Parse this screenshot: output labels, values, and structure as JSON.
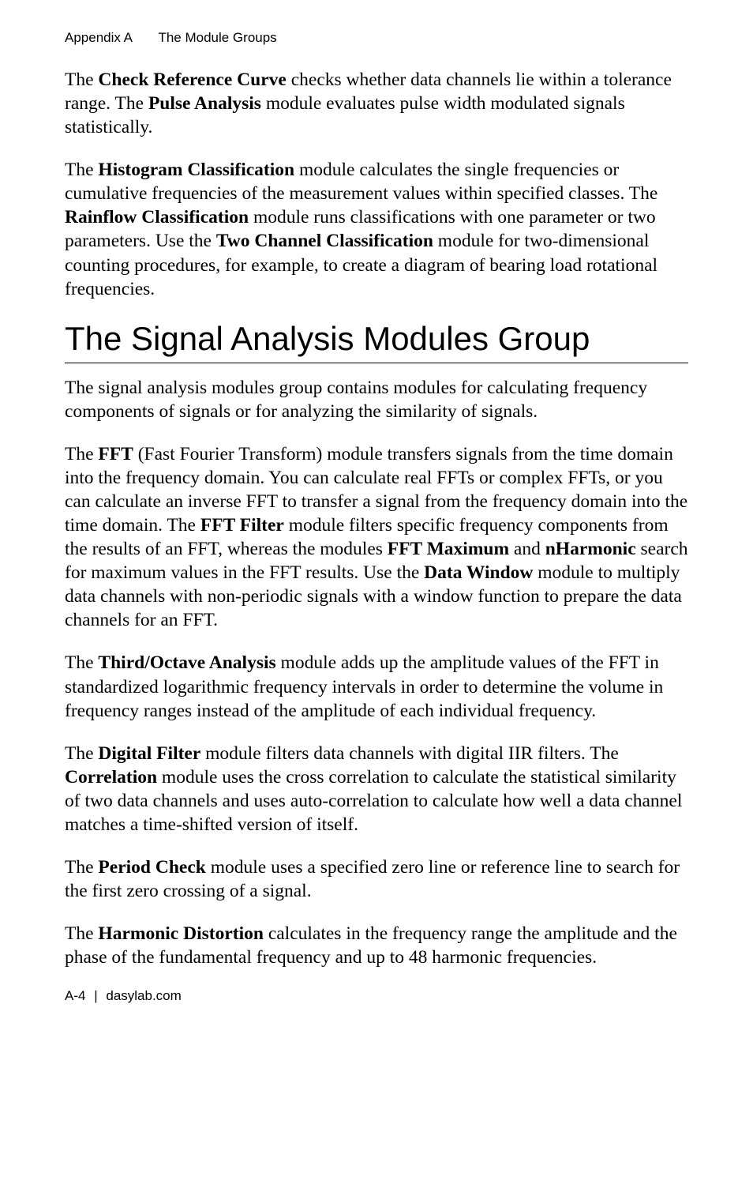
{
  "header": {
    "appendix": "Appendix A",
    "chapter": "The Module Groups"
  },
  "para1": {
    "t1": "The ",
    "b1": "Check Reference Curve",
    "t2": " checks whether data channels lie within a tolerance range. The ",
    "b2": "Pulse Analysis",
    "t3": " module evaluates pulse width modulated signals statistically."
  },
  "para2": {
    "t1": "The ",
    "b1": "Histogram Classification",
    "t2": " module calculates the single frequencies or cumulative frequencies of the measurement values within specified classes. The ",
    "b2": "Rainflow Classification",
    "t3": " module runs classifications with one parameter or two parameters. Use the ",
    "b3": "Two Channel Classification",
    "t4": " module for two-dimensional counting procedures, for example, to create a diagram of bearing load rotational frequencies."
  },
  "section_title": "The Signal Analysis Modules Group",
  "para3": "The signal analysis modules group contains modules for calculating frequency components of signals or for analyzing the similarity of signals.",
  "para4": {
    "t1": "The ",
    "b1": "FFT",
    "t2": " (Fast Fourier Transform) module transfers signals from the time domain into the frequency domain. You can calculate real FFTs or complex FFTs, or you can calculate an inverse FFT to transfer a signal from the frequency domain into the time domain. The ",
    "b2": "FFT Filter",
    "t3": " module filters specific frequency components from the results of an FFT, whereas the modules ",
    "b3": "FFT Maximum",
    "t4": " and ",
    "b4": "nHarmonic",
    "t5": " search for maximum values in the FFT results. Use the ",
    "b5": "Data Window",
    "t6": " module to multiply data channels with non-periodic signals with a window function to prepare the data channels for an FFT."
  },
  "para5": {
    "t1": "The ",
    "b1": "Third/Octave Analysis",
    "t2": " module adds up the amplitude values of the FFT in standardized logarithmic frequency intervals in order to determine the volume in frequency ranges instead of the amplitude of each individual frequency."
  },
  "para6": {
    "t1": "The ",
    "b1": "Digital Filter",
    "t2": " module filters data channels with digital IIR filters. The ",
    "b2": "Correlation",
    "t3": " module uses the cross correlation to calculate the statistical similarity of two data channels and uses auto-correlation to calculate how well a data channel matches a time-shifted version of itself."
  },
  "para7": {
    "t1": "The ",
    "b1": "Period Check",
    "t2": " module uses a specified zero line or reference line to search for the first zero crossing of a signal."
  },
  "para8": {
    "t1": "The ",
    "b1": "Harmonic Distortion",
    "t2": " calculates in the frequency range the amplitude and the phase of the fundamental frequency and up to 48 harmonic frequencies."
  },
  "footer": {
    "page": "A-4",
    "sep": "|",
    "site": "dasylab.com"
  }
}
